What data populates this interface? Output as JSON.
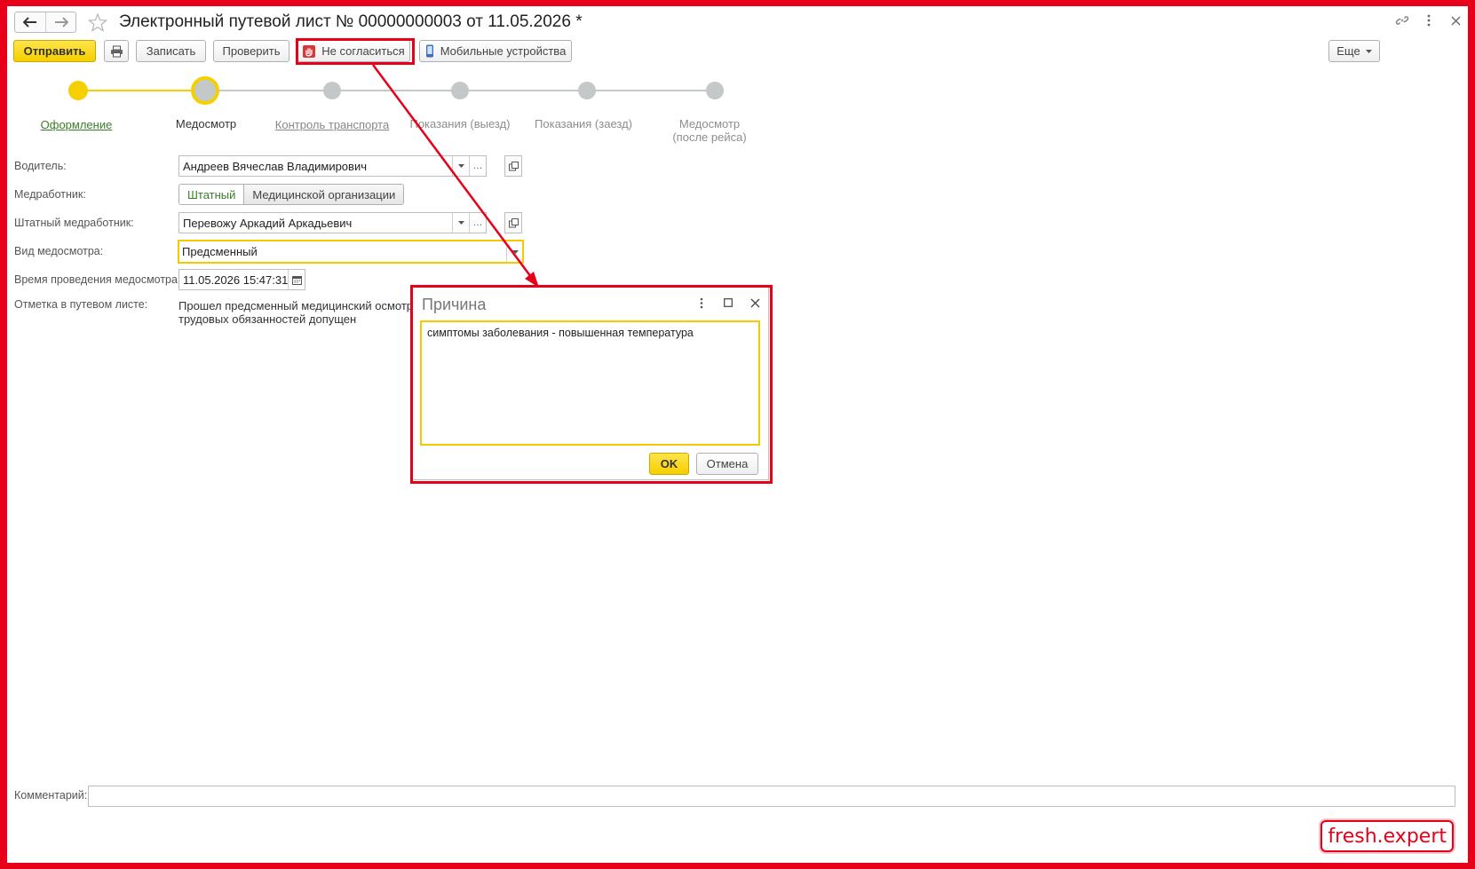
{
  "window": {
    "title": "Электронный путевой лист № 00000000003 от 11.05.2026 *"
  },
  "toolbar": {
    "send": "Отправить",
    "save": "Записать",
    "check": "Проверить",
    "disagree": "Не согласиться",
    "mobile": "Мобильные устройства",
    "more": "Еще"
  },
  "steps": [
    {
      "label": "Оформление",
      "state": "done"
    },
    {
      "label": "Медосмотр",
      "state": "current"
    },
    {
      "label": "Контроль транспорта",
      "state": "link"
    },
    {
      "label": "Показания (выезд)",
      "state": "pending"
    },
    {
      "label": "Показания (заезд)",
      "state": "pending"
    },
    {
      "label": "Медосмотр\n(после рейса)",
      "state": "pending"
    }
  ],
  "form": {
    "driver": {
      "label": "Водитель:",
      "value": "Андреев Вячеслав Владимирович"
    },
    "medic": {
      "label": "Медработник:",
      "options": [
        "Штатный",
        "Медицинской организации"
      ],
      "selected": "Штатный"
    },
    "staff_medic": {
      "label": "Штатный медработник:",
      "value": "Перевожу Аркадий Аркадьевич"
    },
    "exam_type": {
      "label": "Вид медосмотра:",
      "value": "Предсменный"
    },
    "exam_time": {
      "label": "Время проведения медосмотра:",
      "value": "11.05.2026 15:47:31"
    },
    "note": {
      "label": "Отметка в путевом листе:",
      "line1": "Прошел предсменный медицинский осмотр, к",
      "line2": "трудовых обязанностей допущен"
    },
    "comment": {
      "label": "Комментарий:",
      "value": ""
    }
  },
  "dialog": {
    "title": "Причина",
    "text": "симптомы заболевания - повышенная температура",
    "ok": "OK",
    "cancel": "Отмена"
  },
  "watermark": "fresh.expert",
  "colors": {
    "accent_yellow": "#f5cf00",
    "highlight_red": "#e8001b",
    "done_green": "#3a7d28",
    "pending_grey": "#c4c8c8"
  }
}
